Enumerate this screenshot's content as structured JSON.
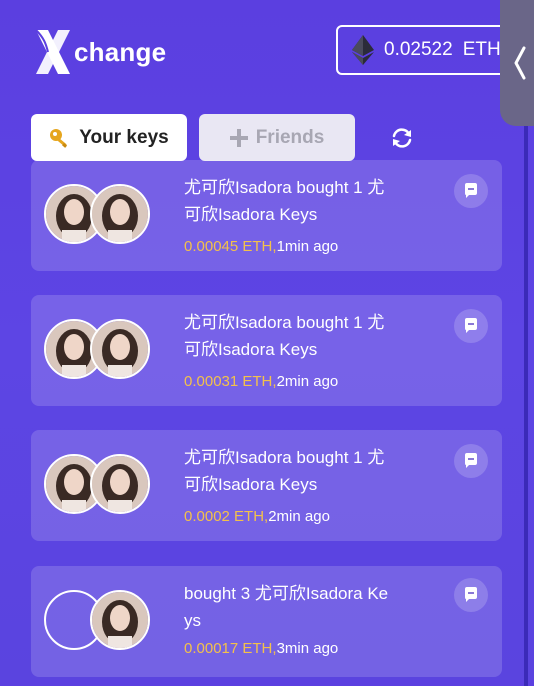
{
  "header": {
    "logo_text": "change",
    "balance_amount": "0.02522",
    "balance_unit": "ETH"
  },
  "tabs": [
    {
      "label": "Your keys",
      "icon": "key-icon",
      "active": true
    },
    {
      "label": "Friends",
      "icon": "plus-icon",
      "active": false
    }
  ],
  "activity": [
    {
      "line1": "尤可欣Isadora bought 1 尤",
      "line2": "可欣Isadora Keys",
      "price": "0.00045 ETH,",
      "time": "1min ago",
      "first_avatar": "photo"
    },
    {
      "line1": "尤可欣Isadora bought 1 尤",
      "line2": "可欣Isadora Keys",
      "price": "0.00031 ETH,",
      "time": "2min ago",
      "first_avatar": "photo"
    },
    {
      "line1": "尤可欣Isadora bought 1 尤",
      "line2": "可欣Isadora Keys",
      "price": "0.0002 ETH,",
      "time": "2min ago",
      "first_avatar": "photo"
    },
    {
      "line1": "bought 3 尤可欣Isadora Ke",
      "line2": "ys",
      "price": "0.00017 ETH,",
      "time": "3min ago",
      "first_avatar": "empty"
    }
  ],
  "colors": {
    "background": "#5b3fe0",
    "price": "#f3c14b",
    "card": "rgba(255,255,255,0.16)"
  }
}
